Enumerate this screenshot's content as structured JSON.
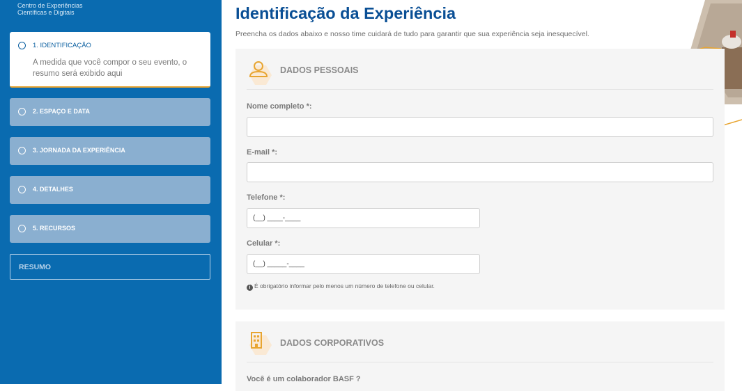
{
  "brand": {
    "line1": "Centro de Experiências",
    "line2": "Científicas e Digitais"
  },
  "steps": [
    {
      "label": "1. IDENTIFICAÇÃO",
      "description": "A medida que você compor o seu evento, o resumo será exibido aqui",
      "active": true
    },
    {
      "label": "2. ESPAÇO E DATA"
    },
    {
      "label": "3. JORNADA DA EXPERIÊNCIA"
    },
    {
      "label": "4. DETALHES"
    },
    {
      "label": "5. RECURSOS"
    }
  ],
  "summary_label": "RESUMO",
  "header": {
    "title": "Identificação da Experiência",
    "subtitle": "Preencha os dados abaixo e nosso time cuidará de tudo para garantir que sua experiência seja inesquecível."
  },
  "personal": {
    "section_title": "DADOS PESSOAIS",
    "icon": "user-icon",
    "fields": {
      "name_label": "Nome completo *:",
      "name_value": "",
      "email_label": "E-mail *:",
      "email_value": "",
      "phone_label": "Telefone *:",
      "phone_placeholder": "(__) ____-____",
      "mobile_label": "Celular *:",
      "mobile_placeholder": "(__) _____-____"
    },
    "note": "É obrigatório informar pelo menos um número de telefone ou celular."
  },
  "corporate": {
    "section_title": "DADOS CORPORATIVOS",
    "icon": "building-icon",
    "question": "Você é um colaborador BASF ?"
  },
  "colors": {
    "sidebar": "#0a6bb0",
    "step_inactive": "#8aafd0",
    "accent_orange": "#e8a531",
    "title_blue": "#0a4f95"
  }
}
